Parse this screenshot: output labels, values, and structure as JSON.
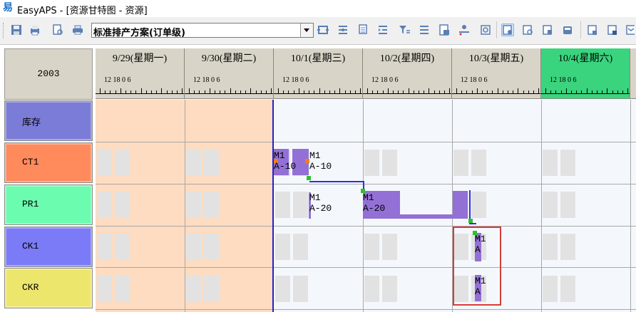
{
  "window": {
    "title": "EasyAPS - [资源甘特图 - 资源]",
    "app_icon": "易"
  },
  "toolbar": {
    "scheme_value": "标准排产方案(订单级)",
    "icons": [
      "save-icon",
      "print-icon",
      "print-preview-icon",
      "printer-icon",
      "expand-icon",
      "align-icon",
      "copy-icon",
      "indent-icon",
      "filter-icon",
      "list-icon",
      "report-icon",
      "resource-icon",
      "refresh-icon",
      "view-a-icon",
      "view-b-icon",
      "view-c-icon",
      "view-d-icon",
      "view-e-icon",
      "view-f-icon",
      "view-g-icon"
    ]
  },
  "gantt": {
    "year": "2003",
    "days": [
      {
        "label": "9/29(星期一)"
      },
      {
        "label": "9/30(星期二)"
      },
      {
        "label": "10/1(星期三)"
      },
      {
        "label": "10/2(星期四)"
      },
      {
        "label": "10/3(星期五)"
      },
      {
        "label": "10/4(星期六)"
      }
    ],
    "hour_ticks": "12  18   0   6",
    "resources": [
      {
        "name": "库存",
        "color": "#7b7bd8"
      },
      {
        "name": "CT1",
        "color": "#ff8a5c"
      },
      {
        "name": "PR1",
        "color": "#6cfcb0"
      },
      {
        "name": "CK1",
        "color": "#7b7bf8"
      },
      {
        "name": "CKR",
        "color": "#ece66c"
      }
    ],
    "tasks": [
      {
        "resource": "CT1",
        "line1": "M1",
        "line2": "A-10"
      },
      {
        "resource": "CT1",
        "line1": "M1",
        "line2": "A-10"
      },
      {
        "resource": "PR1",
        "line1": "M1",
        "line2": "A-20"
      },
      {
        "resource": "PR1",
        "line1": "M1",
        "line2": "A-20"
      },
      {
        "resource": "CK1",
        "line1": "M1",
        "line2": "A"
      },
      {
        "resource": "CKR",
        "line1": "M1",
        "line2": "A"
      }
    ],
    "colors": {
      "today_line": "#2222c8",
      "task": "#9370d6",
      "highlight": "#d93b3b",
      "weekend_header": "#3ad47e"
    }
  }
}
